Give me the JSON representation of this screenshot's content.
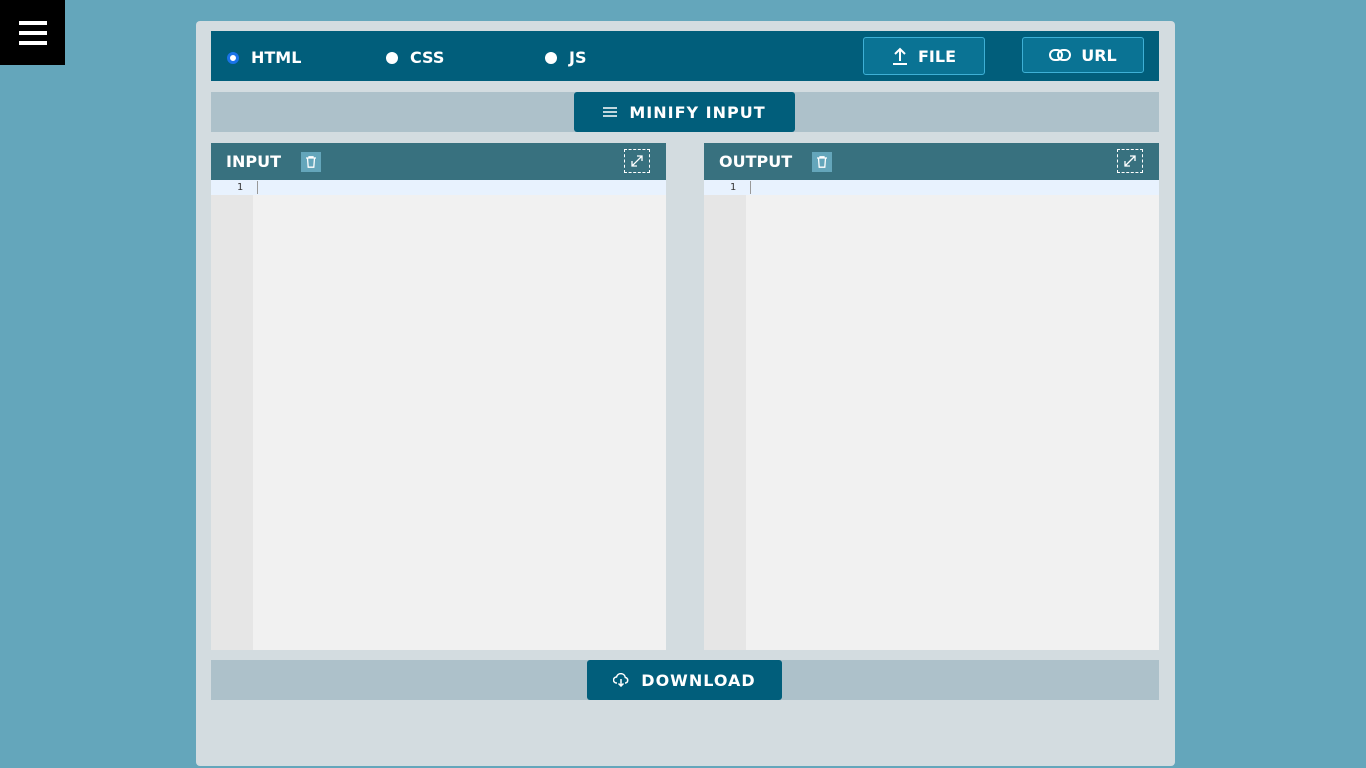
{
  "menu": {
    "icon": "hamburger-icon"
  },
  "modes": [
    {
      "label": "HTML",
      "selected": true
    },
    {
      "label": "CSS",
      "selected": false
    },
    {
      "label": "JS",
      "selected": false
    }
  ],
  "toolbar": {
    "file_label": "FILE",
    "url_label": "URL",
    "minify_label": "MINIFY INPUT",
    "download_label": "DOWNLOAD"
  },
  "input": {
    "title": "INPUT",
    "line_number": "1",
    "value": ""
  },
  "output": {
    "title": "OUTPUT",
    "line_number": "1",
    "value": ""
  },
  "colors": {
    "background": "#64a6bb",
    "primary": "#015e7b",
    "header": "#38717f"
  }
}
